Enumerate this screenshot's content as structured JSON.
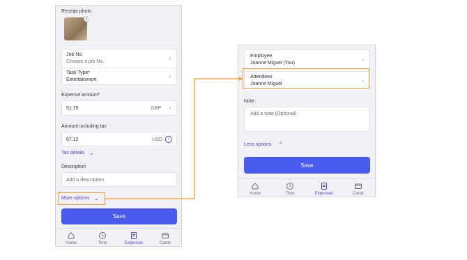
{
  "left": {
    "receipt_label": "Receipt photo",
    "job_no_title": "Job No.",
    "job_no_placeholder": "Choose a job No.",
    "task_type_title": "Task Type*",
    "task_type_value": "Entertainment",
    "expense_amount_label": "Expense amount*",
    "expense_amount_value": "51.75",
    "expense_currency": "GBP",
    "incl_tax_label": "Amount including tax",
    "incl_tax_value": "67.12",
    "incl_tax_currency": "USD",
    "tax_details_link": "Tax details",
    "description_label": "Description",
    "description_placeholder": "Add a description",
    "more_options_link": "More options",
    "save_label": "Save"
  },
  "right": {
    "employee_title": "Employee",
    "employee_value": "Joanne Miguel (You)",
    "attendees_title": "Attendees",
    "attendees_value": "Joanne Miguel",
    "note_label": "Note",
    "note_placeholder": "Add a note (Optional)",
    "less_options_link": "Less options",
    "save_label": "Save"
  },
  "tabs": [
    {
      "label": "Home",
      "icon": "home-icon"
    },
    {
      "label": "Time",
      "icon": "clock-icon"
    },
    {
      "label": "Expenses",
      "icon": "receipt-icon"
    },
    {
      "label": "Cards",
      "icon": "card-icon"
    }
  ],
  "colors": {
    "accent": "#4a5cf0",
    "highlight": "#f59a2c"
  }
}
